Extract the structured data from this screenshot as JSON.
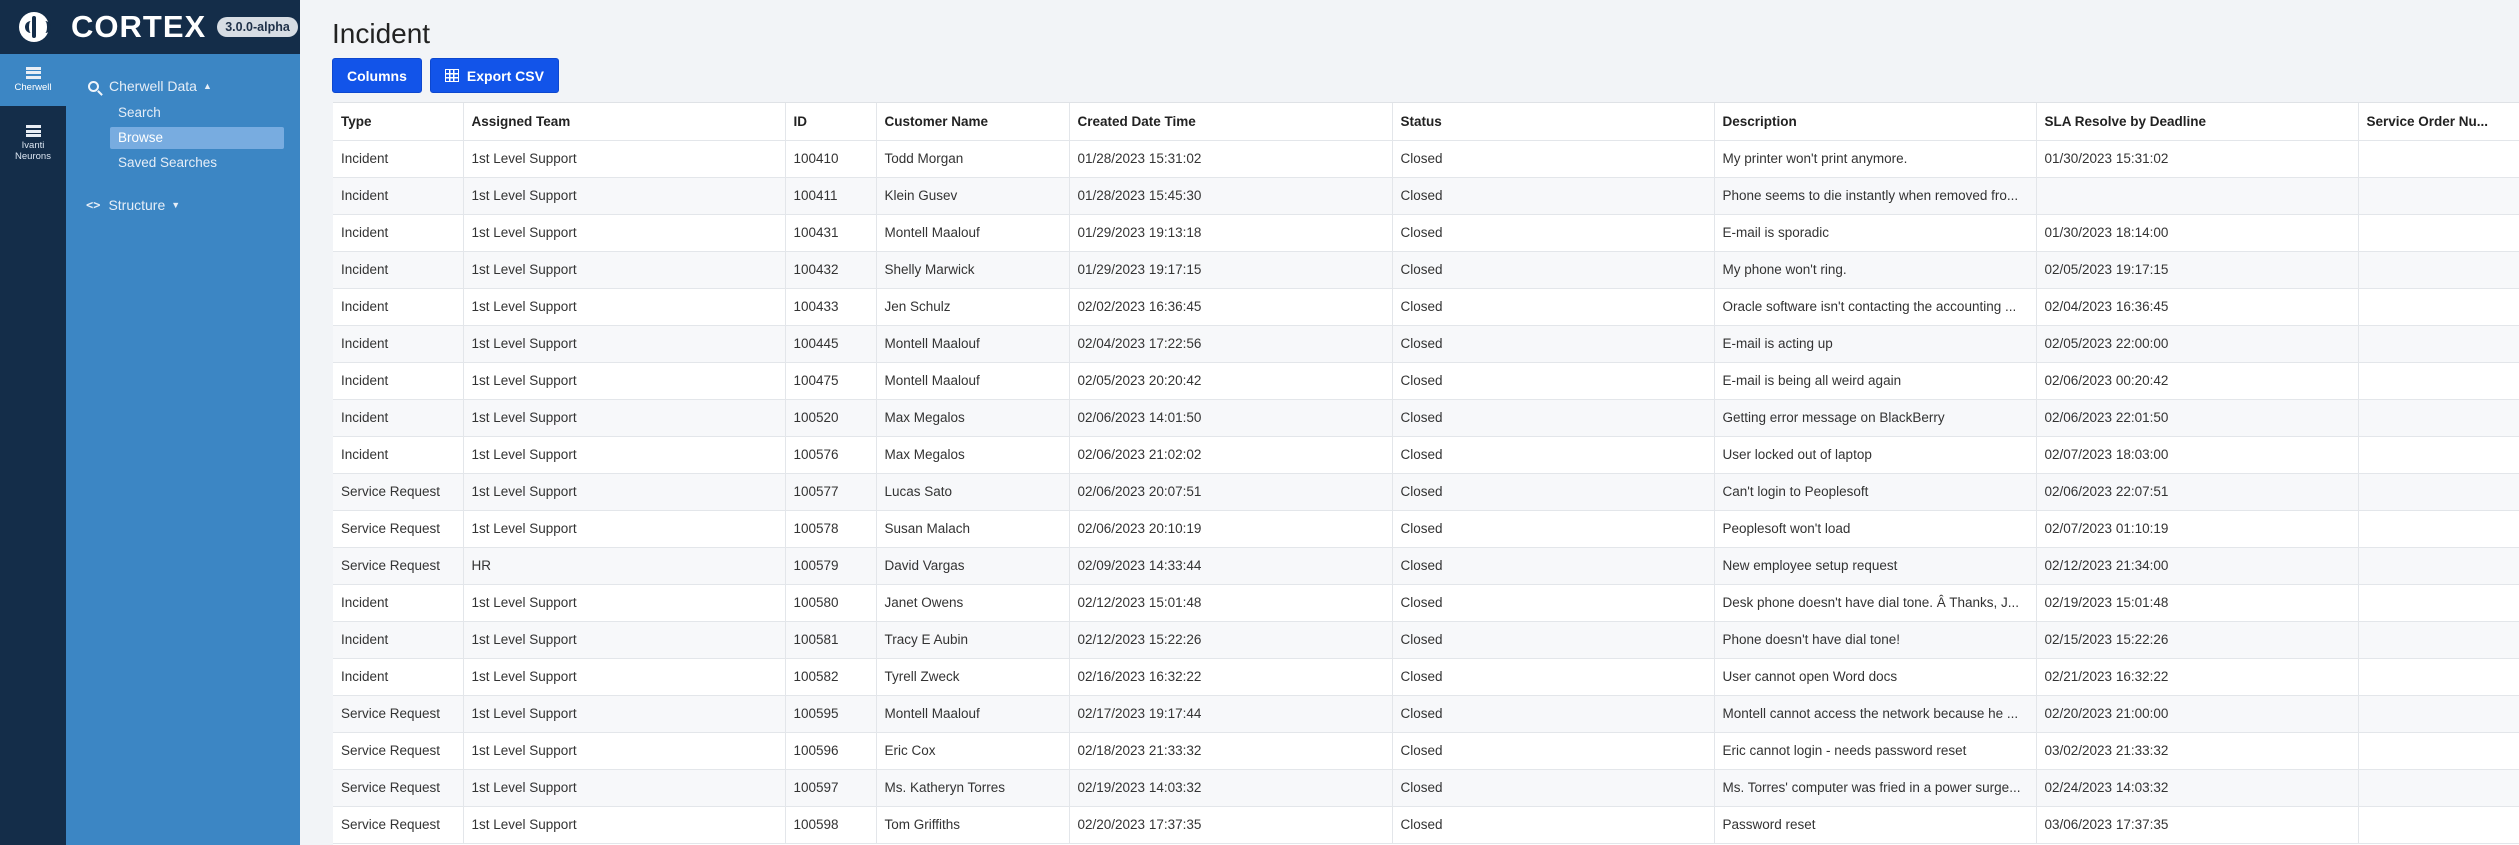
{
  "brand": {
    "name": "CORTEX",
    "version": "3.0.0-alpha"
  },
  "rail": [
    {
      "label": "Cherwell",
      "active": true
    },
    {
      "label": "Ivanti Neurons",
      "active": false
    }
  ],
  "sidebar": {
    "data_section": "Cherwell Data",
    "links": [
      {
        "label": "Search",
        "active": false
      },
      {
        "label": "Browse",
        "active": true
      },
      {
        "label": "Saved Searches",
        "active": false
      }
    ],
    "structure_section": "Structure"
  },
  "page": {
    "title": "Incident",
    "columns_button": "Columns",
    "export_button": "Export CSV"
  },
  "table": {
    "headers": [
      "Type",
      "Assigned Team",
      "ID",
      "Customer Name",
      "Created Date Time",
      "Status",
      "Description",
      "SLA Resolve by Deadline",
      "Service Order Nu..."
    ],
    "rows": [
      [
        "Incident",
        "1st Level Support",
        "100410",
        "Todd Morgan",
        "01/28/2023 15:31:02",
        "Closed",
        "My printer won't print anymore.",
        "01/30/2023 15:31:02",
        ""
      ],
      [
        "Incident",
        "1st Level Support",
        "100411",
        "Klein Gusev",
        "01/28/2023 15:45:30",
        "Closed",
        "Phone seems to die instantly when removed fro...",
        "",
        ""
      ],
      [
        "Incident",
        "1st Level Support",
        "100431",
        "Montell Maalouf",
        "01/29/2023 19:13:18",
        "Closed",
        "E-mail is sporadic",
        "01/30/2023 18:14:00",
        ""
      ],
      [
        "Incident",
        "1st Level Support",
        "100432",
        "Shelly Marwick",
        "01/29/2023 19:17:15",
        "Closed",
        "My phone won't ring.",
        "02/05/2023 19:17:15",
        ""
      ],
      [
        "Incident",
        "1st Level Support",
        "100433",
        "Jen Schulz",
        "02/02/2023 16:36:45",
        "Closed",
        "Oracle software isn't contacting the accounting ...",
        "02/04/2023 16:36:45",
        ""
      ],
      [
        "Incident",
        "1st Level Support",
        "100445",
        "Montell Maalouf",
        "02/04/2023 17:22:56",
        "Closed",
        "E-mail is acting up",
        "02/05/2023 22:00:00",
        ""
      ],
      [
        "Incident",
        "1st Level Support",
        "100475",
        "Montell Maalouf",
        "02/05/2023 20:20:42",
        "Closed",
        "E-mail is being all weird again",
        "02/06/2023 00:20:42",
        ""
      ],
      [
        "Incident",
        "1st Level Support",
        "100520",
        "Max Megalos",
        "02/06/2023 14:01:50",
        "Closed",
        "Getting error message on BlackBerry",
        "02/06/2023 22:01:50",
        ""
      ],
      [
        "Incident",
        "1st Level Support",
        "100576",
        "Max Megalos",
        "02/06/2023 21:02:02",
        "Closed",
        "User locked out of laptop",
        "02/07/2023 18:03:00",
        ""
      ],
      [
        "Service Request",
        "1st Level Support",
        "100577",
        "Lucas Sato",
        "02/06/2023 20:07:51",
        "Closed",
        "Can't login to Peoplesoft",
        "02/06/2023 22:07:51",
        ""
      ],
      [
        "Service Request",
        "1st Level Support",
        "100578",
        "Susan Malach",
        "02/06/2023 20:10:19",
        "Closed",
        "Peoplesoft won't load",
        "02/07/2023 01:10:19",
        ""
      ],
      [
        "Service Request",
        "HR",
        "100579",
        "David Vargas",
        "02/09/2023 14:33:44",
        "Closed",
        "New employee setup request",
        "02/12/2023 21:34:00",
        ""
      ],
      [
        "Incident",
        "1st Level Support",
        "100580",
        "Janet Owens",
        "02/12/2023 15:01:48",
        "Closed",
        "Desk phone doesn't have dial tone. Â  Thanks, J...",
        "02/19/2023 15:01:48",
        ""
      ],
      [
        "Incident",
        "1st Level Support",
        "100581",
        "Tracy E Aubin",
        "02/12/2023 15:22:26",
        "Closed",
        "Phone doesn't have dial tone!",
        "02/15/2023 15:22:26",
        ""
      ],
      [
        "Incident",
        "1st Level Support",
        "100582",
        "Tyrell Zweck",
        "02/16/2023 16:32:22",
        "Closed",
        "User cannot open Word docs",
        "02/21/2023 16:32:22",
        ""
      ],
      [
        "Service Request",
        "1st Level Support",
        "100595",
        "Montell Maalouf",
        "02/17/2023 19:17:44",
        "Closed",
        "Montell cannot access the network because he ...",
        "02/20/2023 21:00:00",
        ""
      ],
      [
        "Service Request",
        "1st Level Support",
        "100596",
        "Eric Cox",
        "02/18/2023 21:33:32",
        "Closed",
        "Eric cannot login - needs password reset",
        "03/02/2023 21:33:32",
        ""
      ],
      [
        "Service Request",
        "1st Level Support",
        "100597",
        "Ms. Katheryn Torres",
        "02/19/2023 14:03:32",
        "Closed",
        "Ms. Torres' computer was fried in a power surge...",
        "02/24/2023 14:03:32",
        ""
      ],
      [
        "Service Request",
        "1st Level Support",
        "100598",
        "Tom Griffiths",
        "02/20/2023 17:37:35",
        "Closed",
        "Password reset",
        "03/06/2023 17:37:35",
        ""
      ]
    ]
  }
}
